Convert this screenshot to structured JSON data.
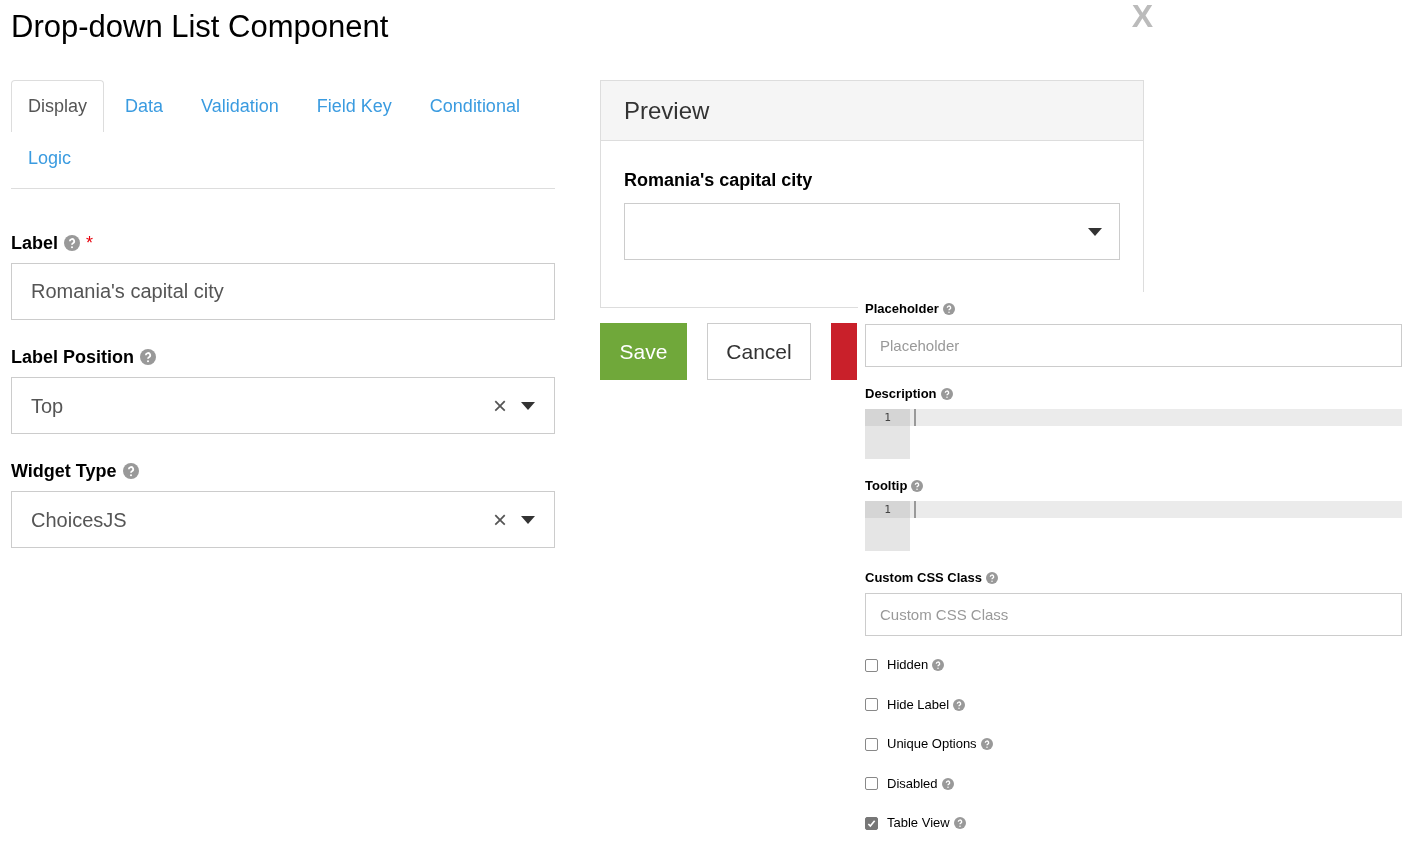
{
  "title": "Drop-down List Component",
  "close": "X",
  "tabs": [
    {
      "label": "Display",
      "selected": true
    },
    {
      "label": "Data",
      "selected": false
    },
    {
      "label": "Validation",
      "selected": false
    },
    {
      "label": "Field Key",
      "selected": false
    },
    {
      "label": "Conditional",
      "selected": false
    },
    {
      "label": "Logic",
      "selected": false
    }
  ],
  "fields": [
    {
      "kind": "text",
      "label": "Label",
      "required_mark": "*",
      "value": "Romania's capital city"
    },
    {
      "kind": "select",
      "label": "Label Position",
      "value": "Top",
      "clear": "×"
    },
    {
      "kind": "select",
      "label": "Widget Type",
      "value": "ChoicesJS",
      "clear": "×"
    }
  ],
  "preview": {
    "title": "Preview",
    "label": "Romania's capital city"
  },
  "buttons": [
    {
      "kind": "save",
      "label": "Save"
    },
    {
      "kind": "cancel",
      "label": "Cancel"
    },
    {
      "kind": "remove"
    }
  ],
  "panel": [
    {
      "kind": "input",
      "label": "Placeholder",
      "placeholder": "Placeholder"
    },
    {
      "kind": "editor",
      "label": "Description",
      "line": "1"
    },
    {
      "kind": "editor",
      "label": "Tooltip",
      "line": "1"
    },
    {
      "kind": "input",
      "label": "Custom CSS Class",
      "placeholder": "Custom CSS Class"
    },
    {
      "kind": "checkbox",
      "label": "Hidden",
      "checked": false
    },
    {
      "kind": "checkbox",
      "label": "Hide Label",
      "checked": false
    },
    {
      "kind": "checkbox",
      "label": "Unique Options",
      "checked": false
    },
    {
      "kind": "checkbox",
      "label": "Disabled",
      "checked": false
    },
    {
      "kind": "checkbox",
      "label": "Table View",
      "checked": true
    }
  ]
}
